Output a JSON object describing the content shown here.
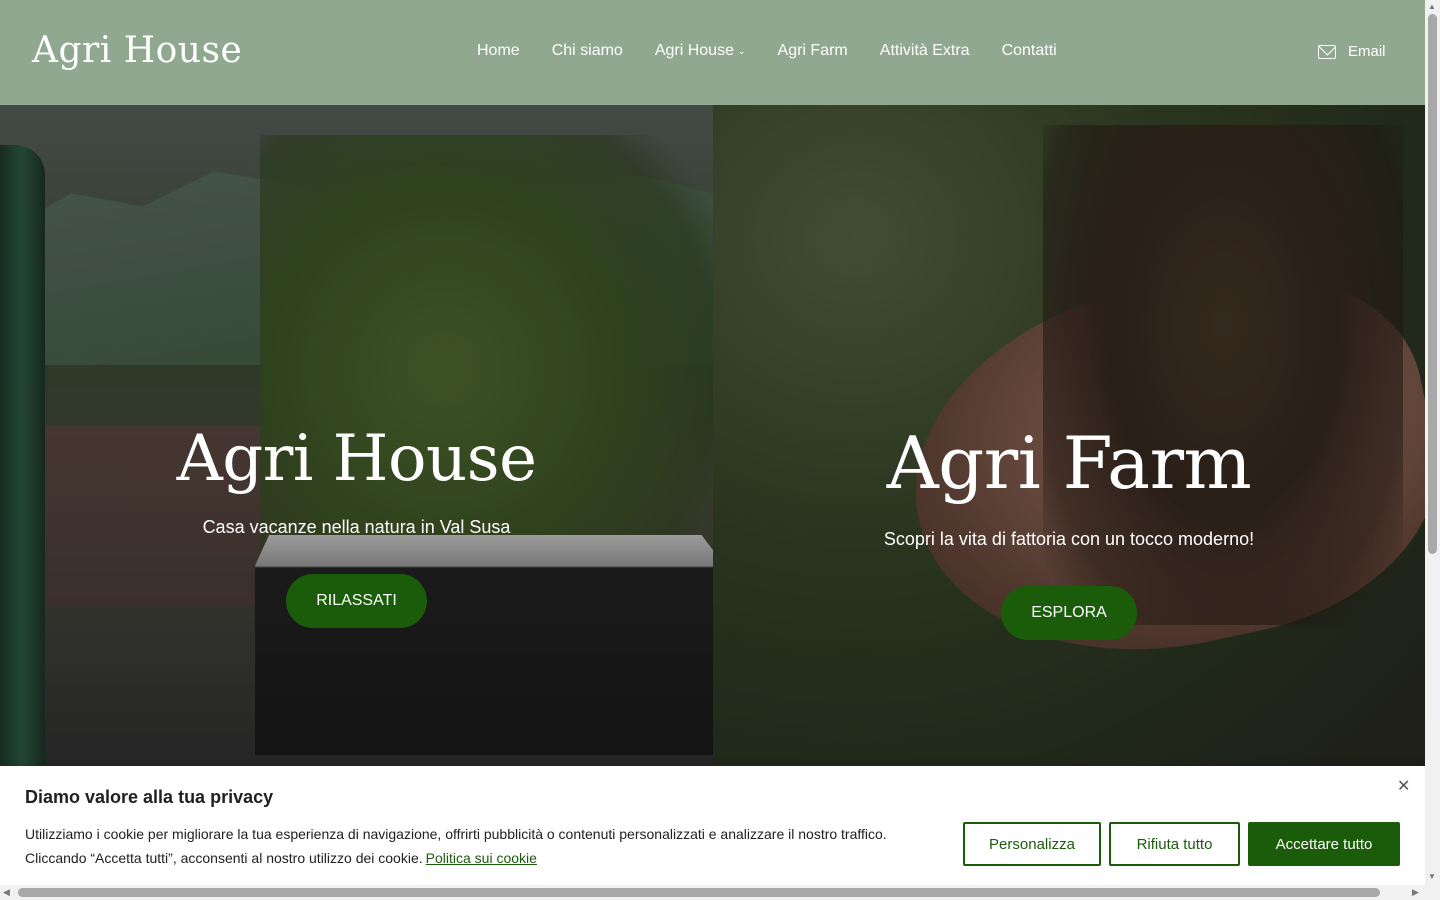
{
  "header": {
    "logo": "Agri House",
    "nav": [
      {
        "label": "Home"
      },
      {
        "label": "Chi siamo"
      },
      {
        "label": "Agri House",
        "has_dropdown": true
      },
      {
        "label": "Agri Farm"
      },
      {
        "label": "Attività Extra"
      },
      {
        "label": "Contatti"
      }
    ],
    "email_label": "Email",
    "email_icon": "mail-icon",
    "background": "#8fa88f"
  },
  "hero": {
    "left": {
      "title": "Agri House",
      "subtitle": "Casa vacanze nella natura in Val Susa",
      "button": "RILASSATI"
    },
    "right": {
      "title": "Agri Farm",
      "subtitle": "Scopri la vita di fattoria con un tocco moderno!",
      "button": "ESPLORA"
    },
    "button_color": "#1a5c0a"
  },
  "cookie_banner": {
    "title": "Diamo valore alla tua privacy",
    "text_line1": "Utilizziamo i cookie per migliorare la tua esperienza di navigazione, offrirti pubblicità o contenuti personalizzati e analizzare il nostro traffico.",
    "text_line2": "Cliccando “Accetta tutti”, acconsenti al nostro utilizzo dei cookie.",
    "policy_link": "Politica sui cookie",
    "buttons": {
      "customize": "Personalizza",
      "reject": "Rifiuta tutto",
      "accept": "Accettare tutto"
    },
    "close_icon": "close-icon",
    "accent": "#1a5c0a"
  }
}
